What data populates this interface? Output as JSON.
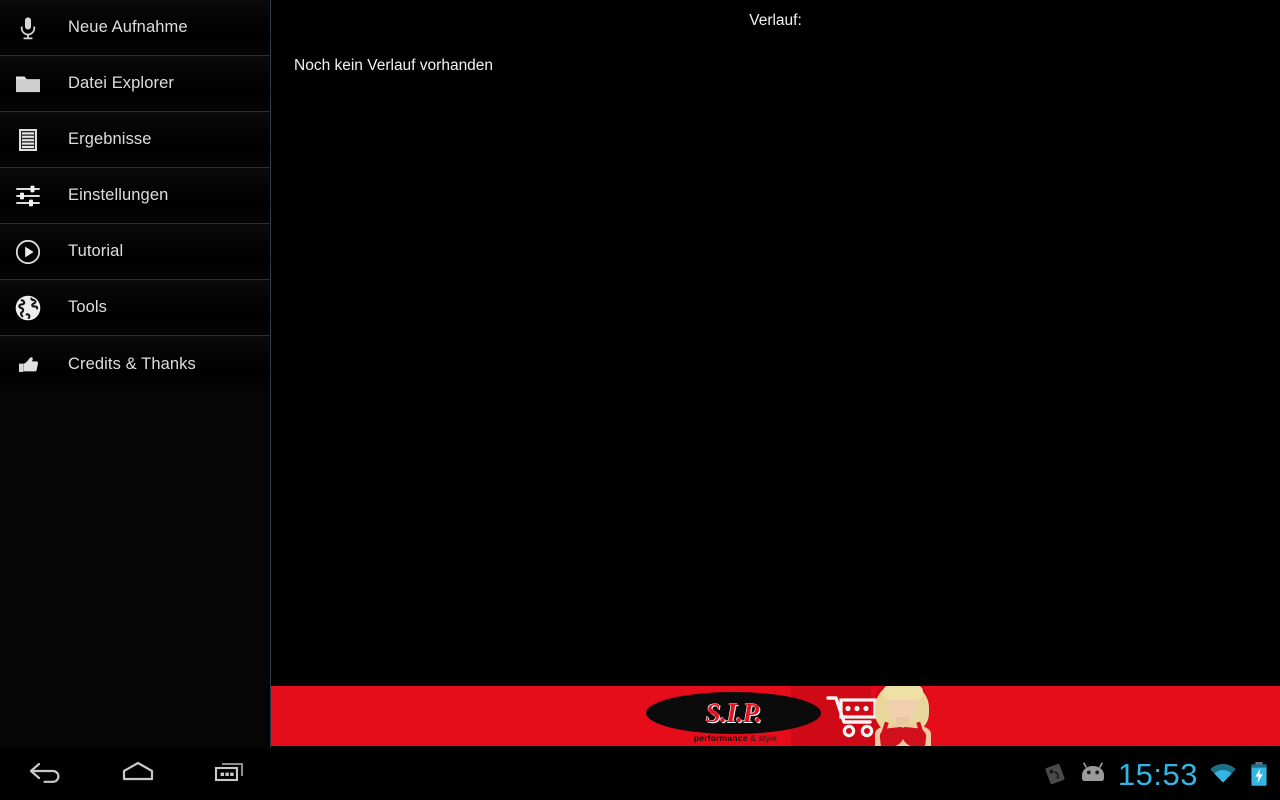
{
  "sidebar": {
    "items": [
      {
        "label": "Neue Aufnahme",
        "icon": "microphone-icon"
      },
      {
        "label": "Datei Explorer",
        "icon": "folder-icon"
      },
      {
        "label": "Ergebnisse",
        "icon": "list-document-icon"
      },
      {
        "label": "Einstellungen",
        "icon": "equalizer-sliders-icon"
      },
      {
        "label": "Tutorial",
        "icon": "play-circle-icon"
      },
      {
        "label": "Tools",
        "icon": "globe-icon"
      },
      {
        "label": "Credits & Thanks",
        "icon": "thumbs-up-icon"
      }
    ]
  },
  "content": {
    "history_title": "Verlauf:",
    "history_empty": "Noch kein Verlauf vorhanden"
  },
  "ad": {
    "brand": "S.I.P.",
    "tagline_bold": "performance",
    "tagline_light": " & style",
    "background_color": "#e60d1a"
  },
  "system_bar": {
    "back_label": "Zurück",
    "home_label": "Home",
    "recents_label": "Letzte Apps",
    "clock": "15:53",
    "clock_color": "#33b5e5",
    "status_icons": [
      "usb-debug-icon",
      "android-robot-icon",
      "wifi-icon",
      "battery-charging-icon"
    ]
  }
}
